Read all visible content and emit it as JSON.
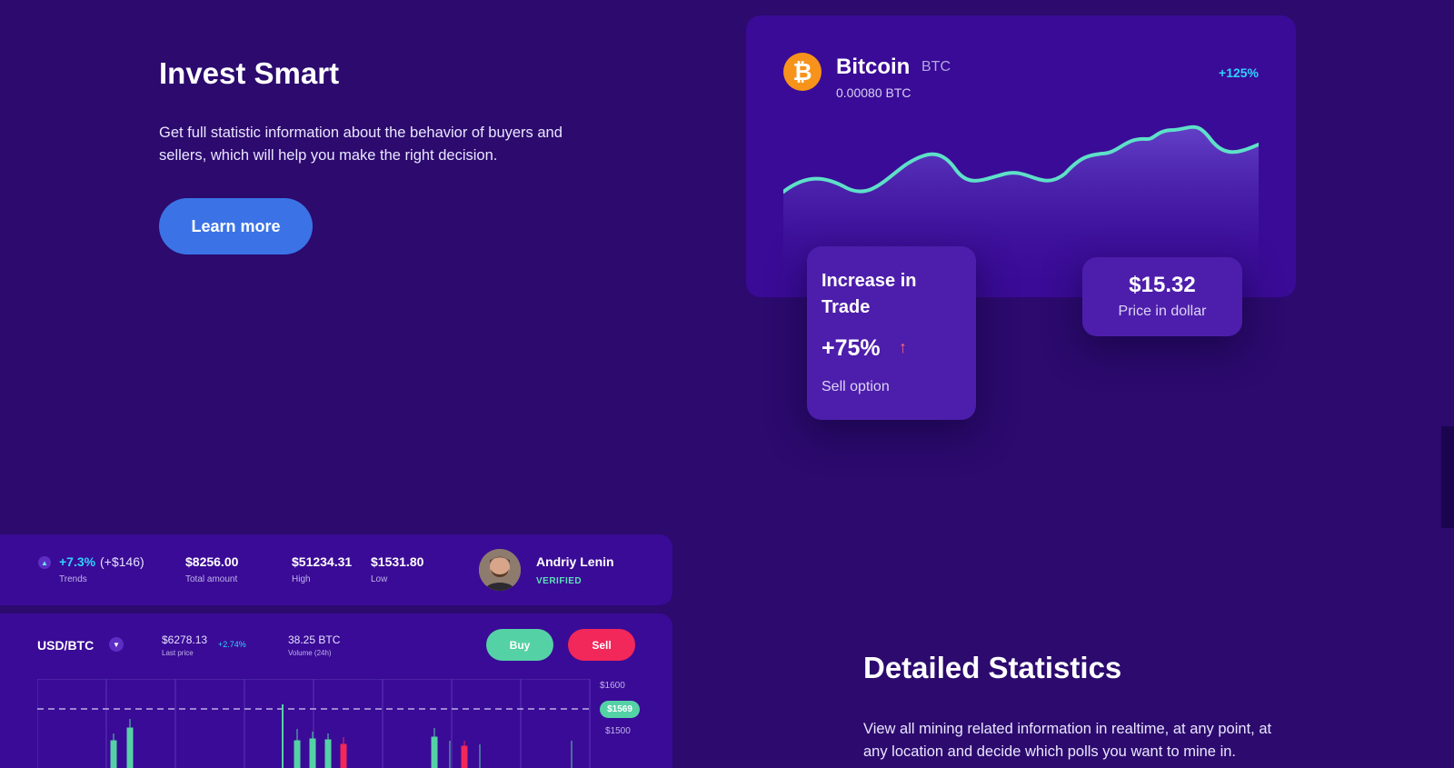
{
  "invest": {
    "title": "Invest Smart",
    "text": "Get full statistic information about the behavior of buyers and sellers, which will help you make the right decision.",
    "cta": "Learn more"
  },
  "bitcoin_card": {
    "icon": "bitcoin-icon",
    "name": "Bitcoin",
    "symbol": "BTC",
    "amount": "0.00080 BTC",
    "change": "+125%",
    "line_color": "#5ee0c8"
  },
  "trade_card": {
    "title": "Increase in Trade",
    "percent": "+75%",
    "arrow_icon": "arrow-up-icon",
    "subtitle": "Sell option"
  },
  "price_card": {
    "value": "$15.32",
    "label": "Price in dollar"
  },
  "stats_bar": {
    "trend_percent": "+7.3%",
    "trend_abs": "(+$146)",
    "trend_label": "Trends",
    "total_value": "$8256.00",
    "total_label": "Total amount",
    "high_value": "$51234.31",
    "high_label": "High",
    "low_value": "$1531.80",
    "low_label": "Low",
    "user_name": "Andriy Lenin",
    "user_status": "VERIFIED"
  },
  "trade_panel": {
    "pair": "USD/BTC",
    "last_price": "$6278.13",
    "last_change": "+2.74%",
    "last_label": "Last price",
    "volume": "38.25 BTC",
    "volume_label": "Volume (24h)",
    "buy_label": "Buy",
    "sell_label": "Sell",
    "tick_1600": "$1600",
    "current_price": "$1569",
    "tick_1500": "$1500"
  },
  "detail": {
    "title": "Detailed Statistics",
    "text": "View all mining related information in realtime, at any point, at any location and decide which polls you want to mine in."
  },
  "colors": {
    "background": "#2c0a6e",
    "card": "#3a0b96",
    "accent_blue": "#3b73e6",
    "positive": "#55d1a6",
    "negative": "#f2275a",
    "bitcoin": "#f7931a"
  }
}
